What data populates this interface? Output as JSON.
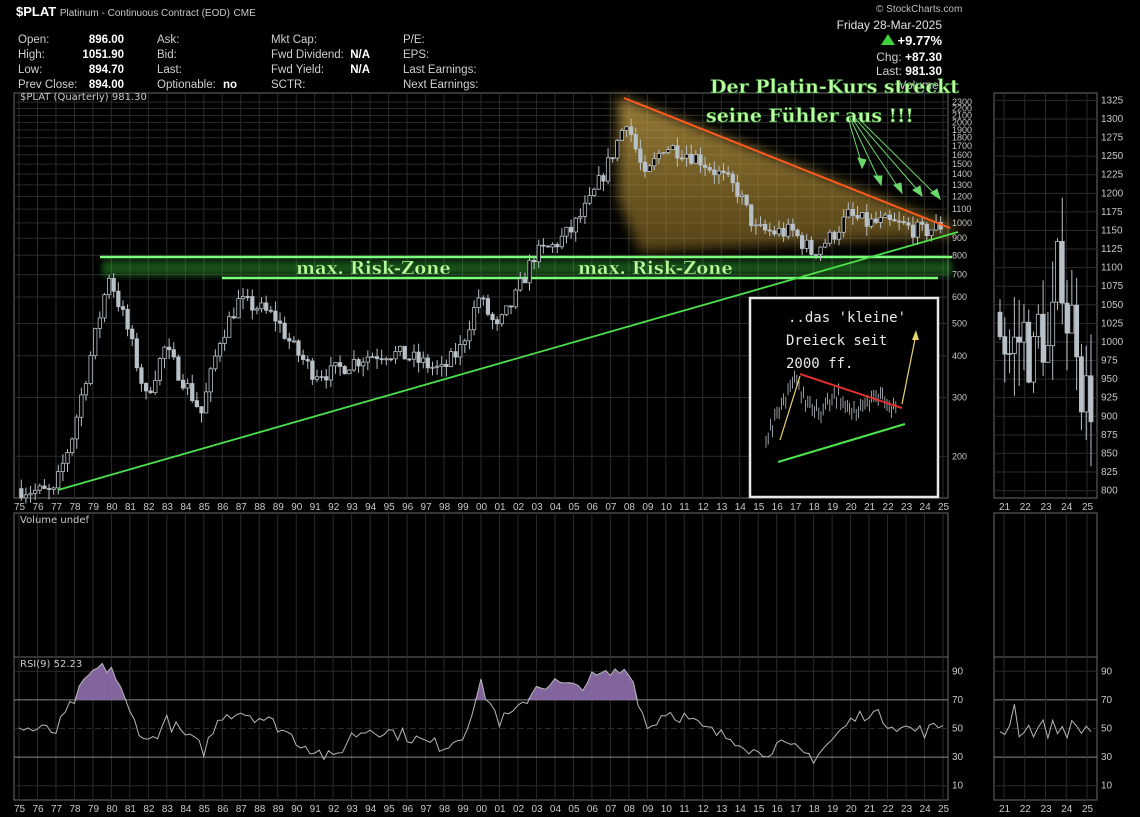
{
  "header": {
    "symbol": "$PLAT",
    "name": "Platinum - Continuous Contract (EOD)",
    "exchange": "CME",
    "logo_text": "© StockCharts.com",
    "date": "Friday  28-Mar-2025",
    "change_pct": "+9.77%",
    "chg_label": "Chg:",
    "chg_value": "+87.30",
    "last_label": "Last:",
    "last_value": "981.30",
    "vol_label": "Volume:",
    "col1": [
      {
        "label": "Open:",
        "value": "896.00"
      },
      {
        "label": "High:",
        "value": "1051.90"
      },
      {
        "label": "Low:",
        "value": "894.70"
      },
      {
        "label": "Prev Close:",
        "value": "894.00"
      }
    ],
    "col2": [
      {
        "label": "Ask:",
        "value": ""
      },
      {
        "label": "Bid:",
        "value": ""
      },
      {
        "label": "Last:",
        "value": ""
      },
      {
        "label": "Optionable:",
        "value": "no"
      }
    ],
    "col3": [
      {
        "label": "Mkt Cap:",
        "value": ""
      },
      {
        "label": "Fwd Dividend:",
        "value": "N/A"
      },
      {
        "label": "Fwd Yield:",
        "value": "N/A"
      },
      {
        "label": "SCTR:",
        "value": ""
      }
    ],
    "col4": [
      {
        "label": "P/E:",
        "value": ""
      },
      {
        "label": "EPS:",
        "value": ""
      },
      {
        "label": "Last Earnings:",
        "value": ""
      },
      {
        "label": "Next Earnings:",
        "value": ""
      }
    ]
  },
  "chart_data": [
    {
      "type": "candlestick",
      "title": "$PLAT (Quarterly) 981.30",
      "scale": "log",
      "y_ticks": [
        200,
        300,
        400,
        500,
        600,
        700,
        800,
        900,
        1000,
        1100,
        1200,
        1300,
        1400,
        1500,
        1600,
        1700,
        1800,
        1900,
        2000,
        2100,
        2200,
        2300
      ],
      "x_ticks": [
        "75",
        "76",
        "77",
        "78",
        "79",
        "80",
        "81",
        "82",
        "83",
        "84",
        "85",
        "86",
        "87",
        "88",
        "89",
        "90",
        "91",
        "92",
        "93",
        "94",
        "95",
        "96",
        "97",
        "98",
        "99",
        "00",
        "01",
        "02",
        "03",
        "04",
        "05",
        "06",
        "07",
        "08",
        "09",
        "10",
        "11",
        "12",
        "13",
        "14",
        "15",
        "16",
        "17",
        "18",
        "19",
        "20",
        "21",
        "22",
        "23",
        "24",
        "25"
      ],
      "approx_closes": [
        {
          "x": "75",
          "y": 160
        },
        {
          "x": "77",
          "y": 155
        },
        {
          "x": "78",
          "y": 230
        },
        {
          "x": "79",
          "y": 400
        },
        {
          "x": "80",
          "y": 700
        },
        {
          "x": "81",
          "y": 480
        },
        {
          "x": "82",
          "y": 300
        },
        {
          "x": "83",
          "y": 420
        },
        {
          "x": "84",
          "y": 340
        },
        {
          "x": "85",
          "y": 270
        },
        {
          "x": "86",
          "y": 450
        },
        {
          "x": "87",
          "y": 580
        },
        {
          "x": "88",
          "y": 560
        },
        {
          "x": "89",
          "y": 520
        },
        {
          "x": "90",
          "y": 420
        },
        {
          "x": "91",
          "y": 360
        },
        {
          "x": "92",
          "y": 355
        },
        {
          "x": "93",
          "y": 380
        },
        {
          "x": "94",
          "y": 400
        },
        {
          "x": "95",
          "y": 410
        },
        {
          "x": "96",
          "y": 400
        },
        {
          "x": "97",
          "y": 380
        },
        {
          "x": "98",
          "y": 360
        },
        {
          "x": "99",
          "y": 420
        },
        {
          "x": "00",
          "y": 600
        },
        {
          "x": "01",
          "y": 480
        },
        {
          "x": "02",
          "y": 600
        },
        {
          "x": "03",
          "y": 800
        },
        {
          "x": "04",
          "y": 850
        },
        {
          "x": "05",
          "y": 950
        },
        {
          "x": "06",
          "y": 1150
        },
        {
          "x": "07",
          "y": 1500
        },
        {
          "x": "08",
          "y": 2050
        },
        {
          "x": "09",
          "y": 1350
        },
        {
          "x": "10",
          "y": 1700
        },
        {
          "x": "11",
          "y": 1650
        },
        {
          "x": "12",
          "y": 1550
        },
        {
          "x": "13",
          "y": 1400
        },
        {
          "x": "14",
          "y": 1250
        },
        {
          "x": "15",
          "y": 950
        },
        {
          "x": "16",
          "y": 940
        },
        {
          "x": "17",
          "y": 940
        },
        {
          "x": "18",
          "y": 820
        },
        {
          "x": "19",
          "y": 900
        },
        {
          "x": "20",
          "y": 1050
        },
        {
          "x": "21",
          "y": 1000
        },
        {
          "x": "22",
          "y": 1000
        },
        {
          "x": "23",
          "y": 980
        },
        {
          "x": "24",
          "y": 940
        },
        {
          "x": "25",
          "y": 981
        }
      ]
    },
    {
      "type": "candlestick",
      "scale": "linear",
      "y_ticks": [
        800,
        825,
        850,
        875,
        900,
        925,
        950,
        975,
        1000,
        1025,
        1050,
        1075,
        1100,
        1125,
        1150,
        1175,
        1200,
        1225,
        1250,
        1275,
        1300,
        1325
      ],
      "x_ticks": [
        "21",
        "22",
        "23",
        "24",
        "25"
      ],
      "ylim": [
        790,
        1335
      ]
    },
    {
      "type": "bar",
      "title": "Volume undef",
      "x_ticks": [
        "75",
        "76",
        "77",
        "78",
        "79",
        "80",
        "81",
        "82",
        "83",
        "84",
        "85",
        "86",
        "87",
        "88",
        "89",
        "90",
        "91",
        "92",
        "93",
        "94",
        "95",
        "96",
        "97",
        "98",
        "99",
        "00",
        "01",
        "02",
        "03",
        "04",
        "05",
        "06",
        "07",
        "08",
        "09",
        "10",
        "11",
        "12",
        "13",
        "14",
        "15",
        "16",
        "17",
        "18",
        "19",
        "20",
        "21",
        "22",
        "23",
        "24",
        "25"
      ]
    },
    {
      "type": "line",
      "title": "RSI(9) 52.23",
      "ylim": [
        0,
        100
      ],
      "y_ticks": [
        10,
        30,
        50,
        70,
        90
      ],
      "x_ticks": [
        "75",
        "76",
        "77",
        "78",
        "79",
        "80",
        "81",
        "82",
        "83",
        "84",
        "85",
        "86",
        "87",
        "88",
        "89",
        "90",
        "91",
        "92",
        "93",
        "94",
        "95",
        "96",
        "97",
        "98",
        "99",
        "00",
        "01",
        "02",
        "03",
        "04",
        "05",
        "06",
        "07",
        "08",
        "09",
        "10",
        "11",
        "12",
        "13",
        "14",
        "15",
        "16",
        "17",
        "18",
        "19",
        "20",
        "21",
        "22",
        "23",
        "24",
        "25"
      ],
      "approx_values": [
        {
          "x": "75",
          "y": 50
        },
        {
          "x": "77",
          "y": 48
        },
        {
          "x": "78",
          "y": 70
        },
        {
          "x": "79",
          "y": 90
        },
        {
          "x": "80",
          "y": 93
        },
        {
          "x": "81",
          "y": 60
        },
        {
          "x": "82",
          "y": 40
        },
        {
          "x": "83",
          "y": 55
        },
        {
          "x": "84",
          "y": 45
        },
        {
          "x": "85",
          "y": 35
        },
        {
          "x": "86",
          "y": 60
        },
        {
          "x": "87",
          "y": 62
        },
        {
          "x": "88",
          "y": 58
        },
        {
          "x": "89",
          "y": 52
        },
        {
          "x": "90",
          "y": 42
        },
        {
          "x": "91",
          "y": 35
        },
        {
          "x": "92",
          "y": 28
        },
        {
          "x": "93",
          "y": 45
        },
        {
          "x": "94",
          "y": 50
        },
        {
          "x": "95",
          "y": 48
        },
        {
          "x": "96",
          "y": 45
        },
        {
          "x": "97",
          "y": 40
        },
        {
          "x": "98",
          "y": 38
        },
        {
          "x": "99",
          "y": 45
        },
        {
          "x": "00",
          "y": 80
        },
        {
          "x": "01",
          "y": 55
        },
        {
          "x": "02",
          "y": 62
        },
        {
          "x": "03",
          "y": 80
        },
        {
          "x": "04",
          "y": 82
        },
        {
          "x": "05",
          "y": 78
        },
        {
          "x": "06",
          "y": 85
        },
        {
          "x": "07",
          "y": 88
        },
        {
          "x": "08",
          "y": 92
        },
        {
          "x": "09",
          "y": 50
        },
        {
          "x": "10",
          "y": 62
        },
        {
          "x": "11",
          "y": 58
        },
        {
          "x": "12",
          "y": 50
        },
        {
          "x": "13",
          "y": 45
        },
        {
          "x": "14",
          "y": 42
        },
        {
          "x": "15",
          "y": 32
        },
        {
          "x": "16",
          "y": 38
        },
        {
          "x": "17",
          "y": 35
        },
        {
          "x": "18",
          "y": 30
        },
        {
          "x": "19",
          "y": 42
        },
        {
          "x": "20",
          "y": 55
        },
        {
          "x": "21",
          "y": 62
        },
        {
          "x": "22",
          "y": 55
        },
        {
          "x": "23",
          "y": 50
        },
        {
          "x": "24",
          "y": 48
        },
        {
          "x": "25",
          "y": 52
        }
      ]
    },
    {
      "type": "line",
      "ylim": [
        0,
        100
      ],
      "y_ticks": [
        10,
        30,
        50,
        70,
        90
      ],
      "x_ticks": [
        "21",
        "22",
        "23",
        "24",
        "25"
      ]
    }
  ],
  "annotations": {
    "title_line1": "Der Platin-Kurs streckt",
    "title_line2": "seine Fühler aus !!!",
    "risk_zone_left": "max. Risk-Zone",
    "risk_zone_right": "max. Risk-Zone",
    "inset_line1": "..das 'kleine'",
    "inset_line2": "Dreieck seit",
    "inset_line3": "2000 ff."
  },
  "colors": {
    "background": "#000000",
    "grid": "#2b2b2b",
    "candle": "#b8c0c8",
    "support_line": "#4ce04c",
    "resistance_line": "#ff5a1e",
    "rsi_fill": "#8a6aa6",
    "annotation_text": "#b9ff9f"
  }
}
